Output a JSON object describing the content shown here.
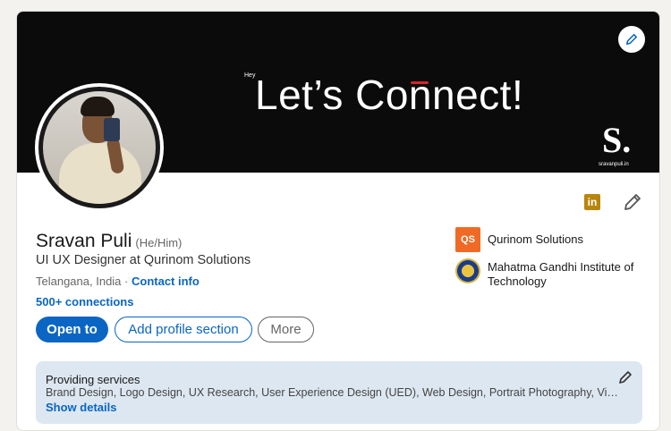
{
  "banner": {
    "small_text": "Hey",
    "title_before": "Let’s Co",
    "title_accent": "n",
    "title_after": "nect!",
    "logo": "S.",
    "url": "sravanpuli.in"
  },
  "profile": {
    "name": "Sravan Puli",
    "pronouns": "(He/Him)",
    "headline": "UI UX Designer at Qurinom Solutions",
    "location": "Telangana, India",
    "separator": " · ",
    "contact_label": "Contact info",
    "connections": "500+ connections"
  },
  "orgs": [
    {
      "name": "Qurinom Solutions",
      "logo_text": "QS"
    },
    {
      "name": "Mahatma Gandhi Institute of Technology"
    }
  ],
  "actions": {
    "open_to": "Open to",
    "add_section": "Add profile section",
    "more": "More"
  },
  "services": {
    "title": "Providing services",
    "list": "Brand Design, Logo Design, UX Research, User Experience Design (UED), Web Design, Portrait Photography, Video Editing",
    "link": "Show details"
  },
  "linkedin_icon": "in",
  "colors": {
    "accent": "#0a66c2",
    "banner_bg": "#0b0b0b",
    "banner_accent": "#d4262b",
    "services_bg": "#dde7f1"
  }
}
